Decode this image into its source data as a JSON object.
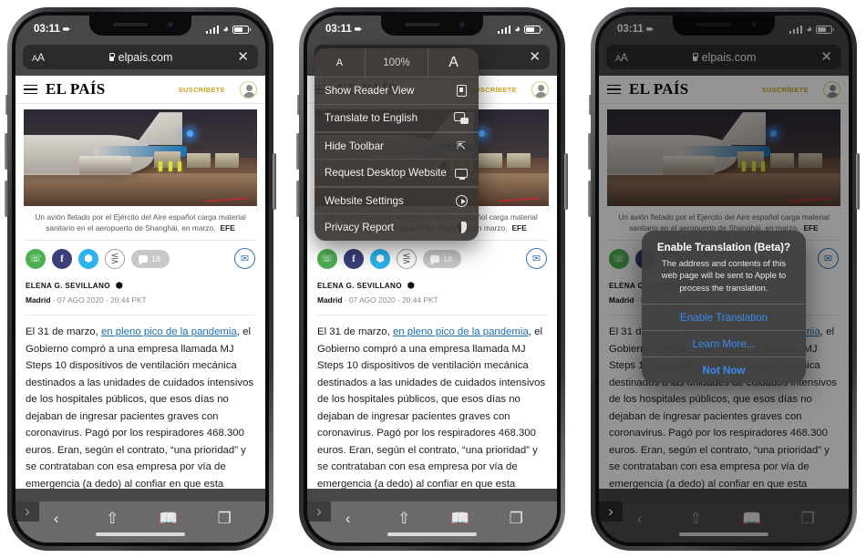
{
  "status_bar": {
    "time": "03:11",
    "location_icon": "location-arrow-icon",
    "signal_icon": "cellular-signal-icon",
    "wifi_icon": "wifi-icon",
    "battery_icon": "battery-icon"
  },
  "url_bar": {
    "text_size_label": "AA",
    "lock_icon": "lock-icon",
    "domain": "elpais.com",
    "close_label": "✕"
  },
  "site": {
    "menu_icon": "hamburger-menu-icon",
    "brand": "EL PAÍS",
    "subscribe": "SUSCRÍBETE",
    "avatar_icon": "user-avatar-icon"
  },
  "article": {
    "photo_alt": "cargo-plane-unloading-photo",
    "caption": "Un avión fletado por el Ejército del Aire español carga material sanitario en el aeropuerto de Shanghái, en marzo.",
    "caption_credit": "EFE",
    "share": {
      "whatsapp": "whatsapp-icon",
      "facebook": "facebook-icon",
      "twitter": "twitter-icon",
      "share": "share-icon",
      "comments_count": "18",
      "email": "email-icon"
    },
    "author": "ELENA G. SEVILLANO",
    "author_twitter_icon": "twitter-bird-icon",
    "location": "Madrid",
    "date": "- 07 AGO 2020 - 20:44 PKT",
    "body_pre_link": "El 31 de marzo, ",
    "body_link": "en pleno pico de la pandemia",
    "body_post_link": ", el Gobierno compró a una empresa llamada MJ Steps 10 dispositivos de ventilación mecánica destinados a las unidades de cuidados intensivos de los hospitales públicos, que esos días no dejaban de ingresar pacientes graves con coronavirus. Pagó por los respiradores 468.300 euros. Eran, según el contrato, “una prioridad” y se contrataban con esa empresa por vía de emergencia (a dedo) al confiar en que esta"
  },
  "toolbar": {
    "back": "‹",
    "forward": "›",
    "share_icon": "share-up-icon",
    "bookmarks_icon": "book-icon",
    "tabs_icon": "tabs-icon"
  },
  "aa_menu": {
    "size_small": "A",
    "size_percent": "100%",
    "size_large": "A",
    "items": [
      {
        "label": "Show Reader View",
        "icon": "reader-view-icon"
      },
      {
        "label": "Translate to English",
        "icon": "translate-icon"
      },
      {
        "label": "Hide Toolbar",
        "icon": "hide-toolbar-icon"
      },
      {
        "label": "Request Desktop Website",
        "icon": "desktop-monitor-icon"
      },
      {
        "label": "Website Settings",
        "icon": "website-settings-icon"
      },
      {
        "label": "Privacy Report",
        "icon": "privacy-shield-icon"
      }
    ]
  },
  "alert": {
    "title": "Enable Translation (Beta)?",
    "message": "The address and contents of this web page will be sent to Apple to process the translation.",
    "buttons": [
      {
        "label": "Enable Translation",
        "bold": false
      },
      {
        "label": "Learn More...",
        "bold": false
      },
      {
        "label": "Not Now",
        "bold": true
      }
    ]
  },
  "colors": {
    "accent_blue": "#3b8cf0",
    "link_blue": "#1a6fae",
    "brand_gold": "#c9a227",
    "chrome_gray": "#474747"
  }
}
